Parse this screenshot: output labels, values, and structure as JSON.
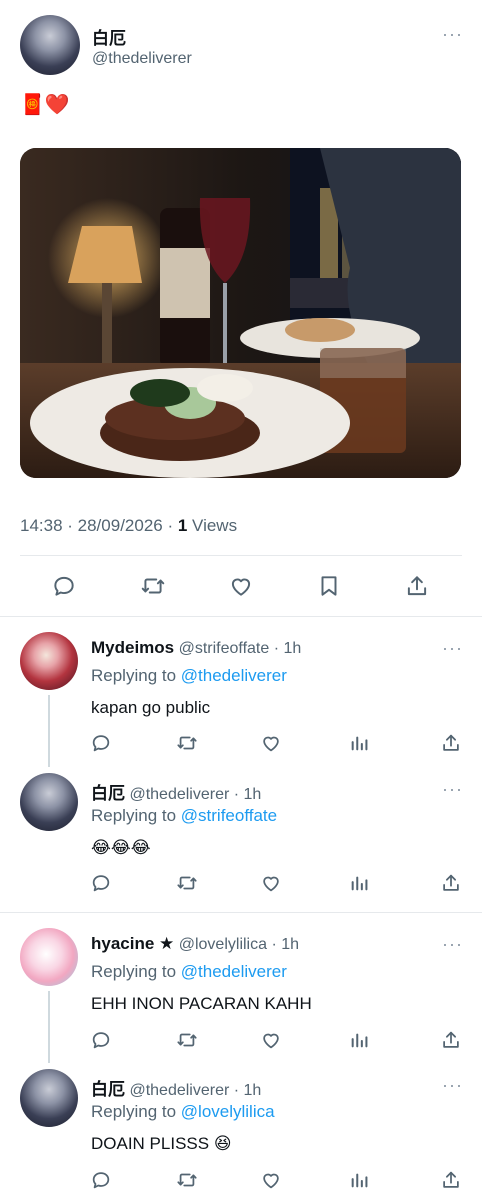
{
  "tweet": {
    "author_name": "白厄",
    "author_handle": "@thedeliverer",
    "text": "🧧❤️",
    "timestamp": "14:38 · 28/09/2026 · ",
    "views_count": "1",
    "views_label": " Views",
    "more": "···"
  },
  "replies": [
    {
      "name": "Mydeimos",
      "handle": "@strifeoffate",
      "time": "· 1h",
      "replying_label": "Replying to ",
      "replying_to": "@thedeliverer",
      "text": "kapan go public"
    },
    {
      "name": "白厄",
      "handle": "@thedeliverer",
      "time": "· 1h",
      "replying_label": "Replying to ",
      "replying_to": "@strifeoffate",
      "text": "😂😂😂"
    },
    {
      "name": "hyacine ★",
      "handle": "@lovelylilica",
      "time": "· 1h",
      "replying_label": "Replying to ",
      "replying_to": "@thedeliverer",
      "text": "EHH INON PACARAN KAHH"
    },
    {
      "name": "白厄",
      "handle": "@thedeliverer",
      "time": "· 1h",
      "replying_label": "Replying to ",
      "replying_to": "@lovelylilica",
      "text": "DOAIN PLISSS 😆"
    }
  ],
  "colors": {
    "link": "#1d9bf0",
    "muted": "#536471",
    "icon": "#536471",
    "divider": "#e6e9ec"
  }
}
